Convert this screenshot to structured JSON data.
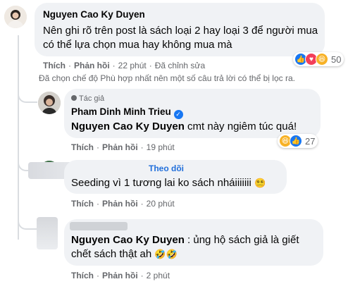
{
  "comments": [
    {
      "author": "Nguyen Cao Ky Duyen",
      "text": "Nên ghi rõ trên post là sách loại 2 hay loại 3 để người mua có thể lựa chọn mua hay không mua mà",
      "reaction_count": "50",
      "reactions": [
        "like-icon",
        "love-icon",
        "haha-icon"
      ],
      "actions": {
        "like": "Thích",
        "reply": "Phản hồi",
        "time": "22 phút",
        "edited": "Đã chỉnh sửa"
      }
    }
  ],
  "filter_note": "Đã chọn chế độ Phù hợp nhất nên một số câu trả lời có thể bị lọc ra.",
  "replies": [
    {
      "badge": "Tác giả",
      "author": "Pham Dinh Minh Trieu",
      "tag": "Nguyen Cao Ky Duyen",
      "text": " cmt này ngiêm túc quá!",
      "reaction_count": "27",
      "reactions": [
        "haha-icon",
        "like-icon"
      ],
      "actions": {
        "like": "Thích",
        "reply": "Phản hồi",
        "time": "19 phút"
      }
    },
    {
      "follow": "Theo dõi",
      "text": "Seeding vì 1 tương lai ko sách nháiiiiiii",
      "emoji": "😵‍💫",
      "actions": {
        "like": "Thích",
        "reply": "Phản hồi",
        "time": "20 phút"
      }
    },
    {
      "tag": "Nguyen Cao Ky Duyen",
      "text": " : ủng hộ sách giả là giết chết sách thật ah",
      "emoji": "🤣🤣",
      "actions": {
        "like": "Thích",
        "reply": "Phản hồi",
        "time": "2 phút"
      }
    }
  ]
}
